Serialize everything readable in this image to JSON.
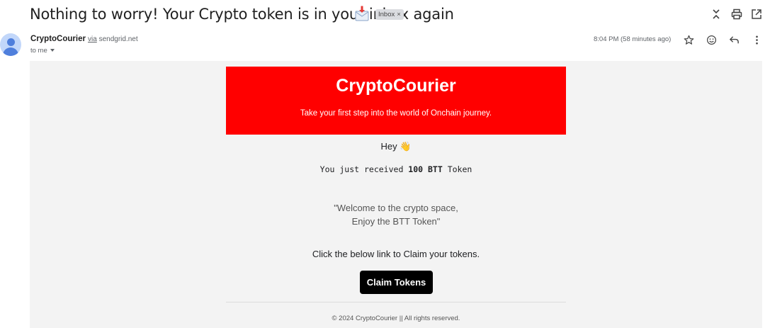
{
  "email": {
    "subject": "Nothing to worry! Your Crypto token is in your inbox again",
    "subject_emoji_icon": "envelope-with-arrow-icon",
    "label_chip": "Inbox",
    "label_chip_close": "×"
  },
  "sender": {
    "name": "CryptoCourier",
    "via_label": "via",
    "via_domain": "sendgrid.net",
    "to": "to me",
    "time": "8:04 PM (58 minutes ago)"
  },
  "toolbar_icons": [
    "expand-collapse-icon",
    "print-icon",
    "open-in-new-window-icon"
  ],
  "action_icons": [
    "star-icon",
    "emoji-reaction-icon",
    "reply-icon",
    "more-options-icon"
  ],
  "body": {
    "banner_title": "CryptoCourier",
    "banner_subtitle": "Take your first step into the world of Onchain journey.",
    "greeting": "Hey",
    "greeting_emoji": "👋",
    "received_prefix": "You just received ",
    "received_amount": "100 BTT",
    "received_suffix": " Token",
    "welcome_line1": "\"Welcome to the crypto space,",
    "welcome_line2": "Enjoy the BTT Token\"",
    "claim_text": "Click the below link to Claim your tokens.",
    "claim_button": "Claim Tokens",
    "footer": "© 2024 CryptoCourier || All rights reserved."
  },
  "colors": {
    "banner": "#ff0000",
    "button": "#000000",
    "canvas": "#f3f3f3"
  }
}
